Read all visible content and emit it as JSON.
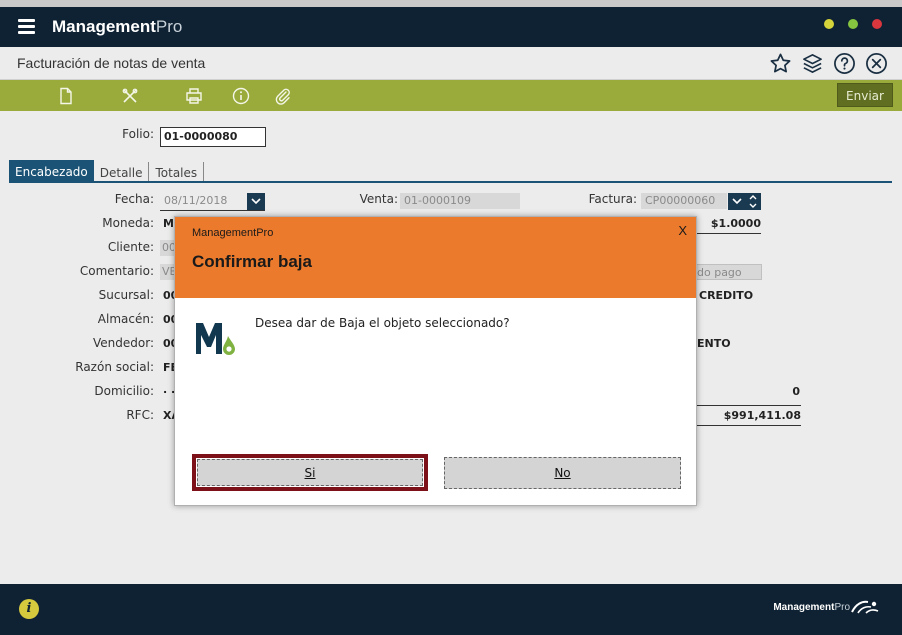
{
  "app": {
    "brand_bold": "Management",
    "brand_light": "Pro",
    "window_controls": {
      "minimize_color": "#d5d43b",
      "maximize_color": "#86c540",
      "close_color": "#d9363e"
    }
  },
  "page": {
    "title": "Facturación de notas de venta",
    "title_icons": [
      "star-icon",
      "layers-icon",
      "help-icon",
      "close-circle-icon"
    ]
  },
  "toolbar": {
    "icons": [
      "new-document-icon",
      "delete-icon",
      "print-icon",
      "info-icon",
      "attach-icon"
    ],
    "send_label": "Enviar"
  },
  "form": {
    "folio_label": "Folio:",
    "folio_value": "01-0000080",
    "tabs": [
      {
        "label": "Encabezado",
        "active": true
      },
      {
        "label": "Detalle",
        "active": false
      },
      {
        "label": "Totales",
        "active": false
      }
    ],
    "fecha_label": "Fecha:",
    "fecha_value": "08/11/2018",
    "venta_label": "Venta:",
    "venta_value": "01-0000109",
    "factura_label": "Factura:",
    "factura_value": "CP00000060",
    "moneda_label": "Moneda:",
    "moneda_value": "M",
    "tipo_cambio_value": "$1.0000",
    "cliente_label": "Cliente:",
    "cliente_value": "00",
    "comentario_label": "Comentario:",
    "comentario_value": "VE",
    "metodo_pago_placeholder": "do pago",
    "sucursal_label": "Sucursal:",
    "sucursal_value": "00",
    "credito_value": "CREDITO",
    "almacen_label": "Almacén:",
    "almacen_value": "00",
    "vendedor_label": "Vendedor:",
    "vendedor_value": "00",
    "vento_value": "ENTO",
    "razon_label": "Razón social:",
    "razon_value": "FE",
    "domicilio_label": "Domicilio:",
    "domicilio_value": ". .",
    "zero_value": "0",
    "rfc_label": "RFC:",
    "rfc_value": "XA",
    "total_value": "$991,411.08"
  },
  "modal": {
    "app_name": "ManagementPro",
    "close_label": "X",
    "title": "Confirmar baja",
    "message": "Desea dar de Baja el objeto seleccionado?",
    "yes_label": "Si",
    "no_label": "No",
    "header_color": "#ec7a2c"
  },
  "footer": {
    "brand_bold": "Management",
    "brand_light": "Pro"
  }
}
